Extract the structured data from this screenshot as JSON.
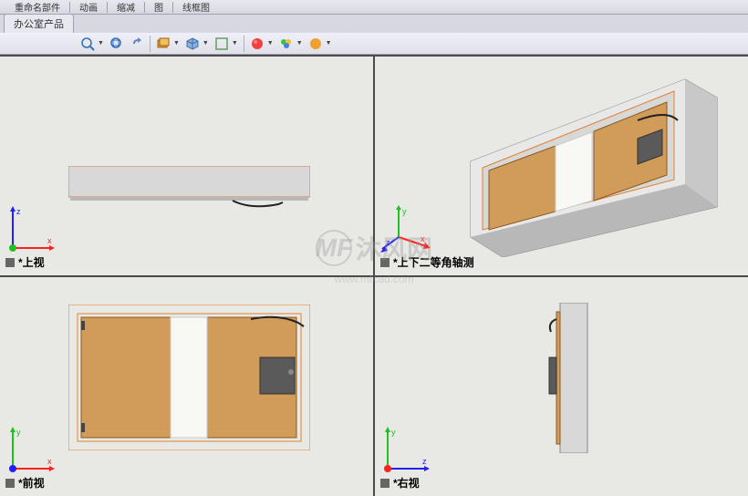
{
  "ribbon": {
    "items": [
      "重命名部件",
      "动画",
      "缩减",
      "图",
      "线框图"
    ]
  },
  "tab": {
    "label": "办公室产品"
  },
  "views": {
    "top": {
      "label": "*上视"
    },
    "iso": {
      "label": "*上下二等角轴测"
    },
    "front": {
      "label": "*前视"
    },
    "right": {
      "label": "*右视"
    }
  },
  "watermark": {
    "text": "沐风网",
    "sub": "www.mfcad.com",
    "logo": "MF"
  },
  "axes": {
    "x": "x",
    "y": "y",
    "z": "z"
  },
  "colors": {
    "cabinet_body": "#d0d0d0",
    "cabinet_door": "#d19b5a",
    "cabinet_edge": "#e08030",
    "panel": "#5a5a5a"
  }
}
